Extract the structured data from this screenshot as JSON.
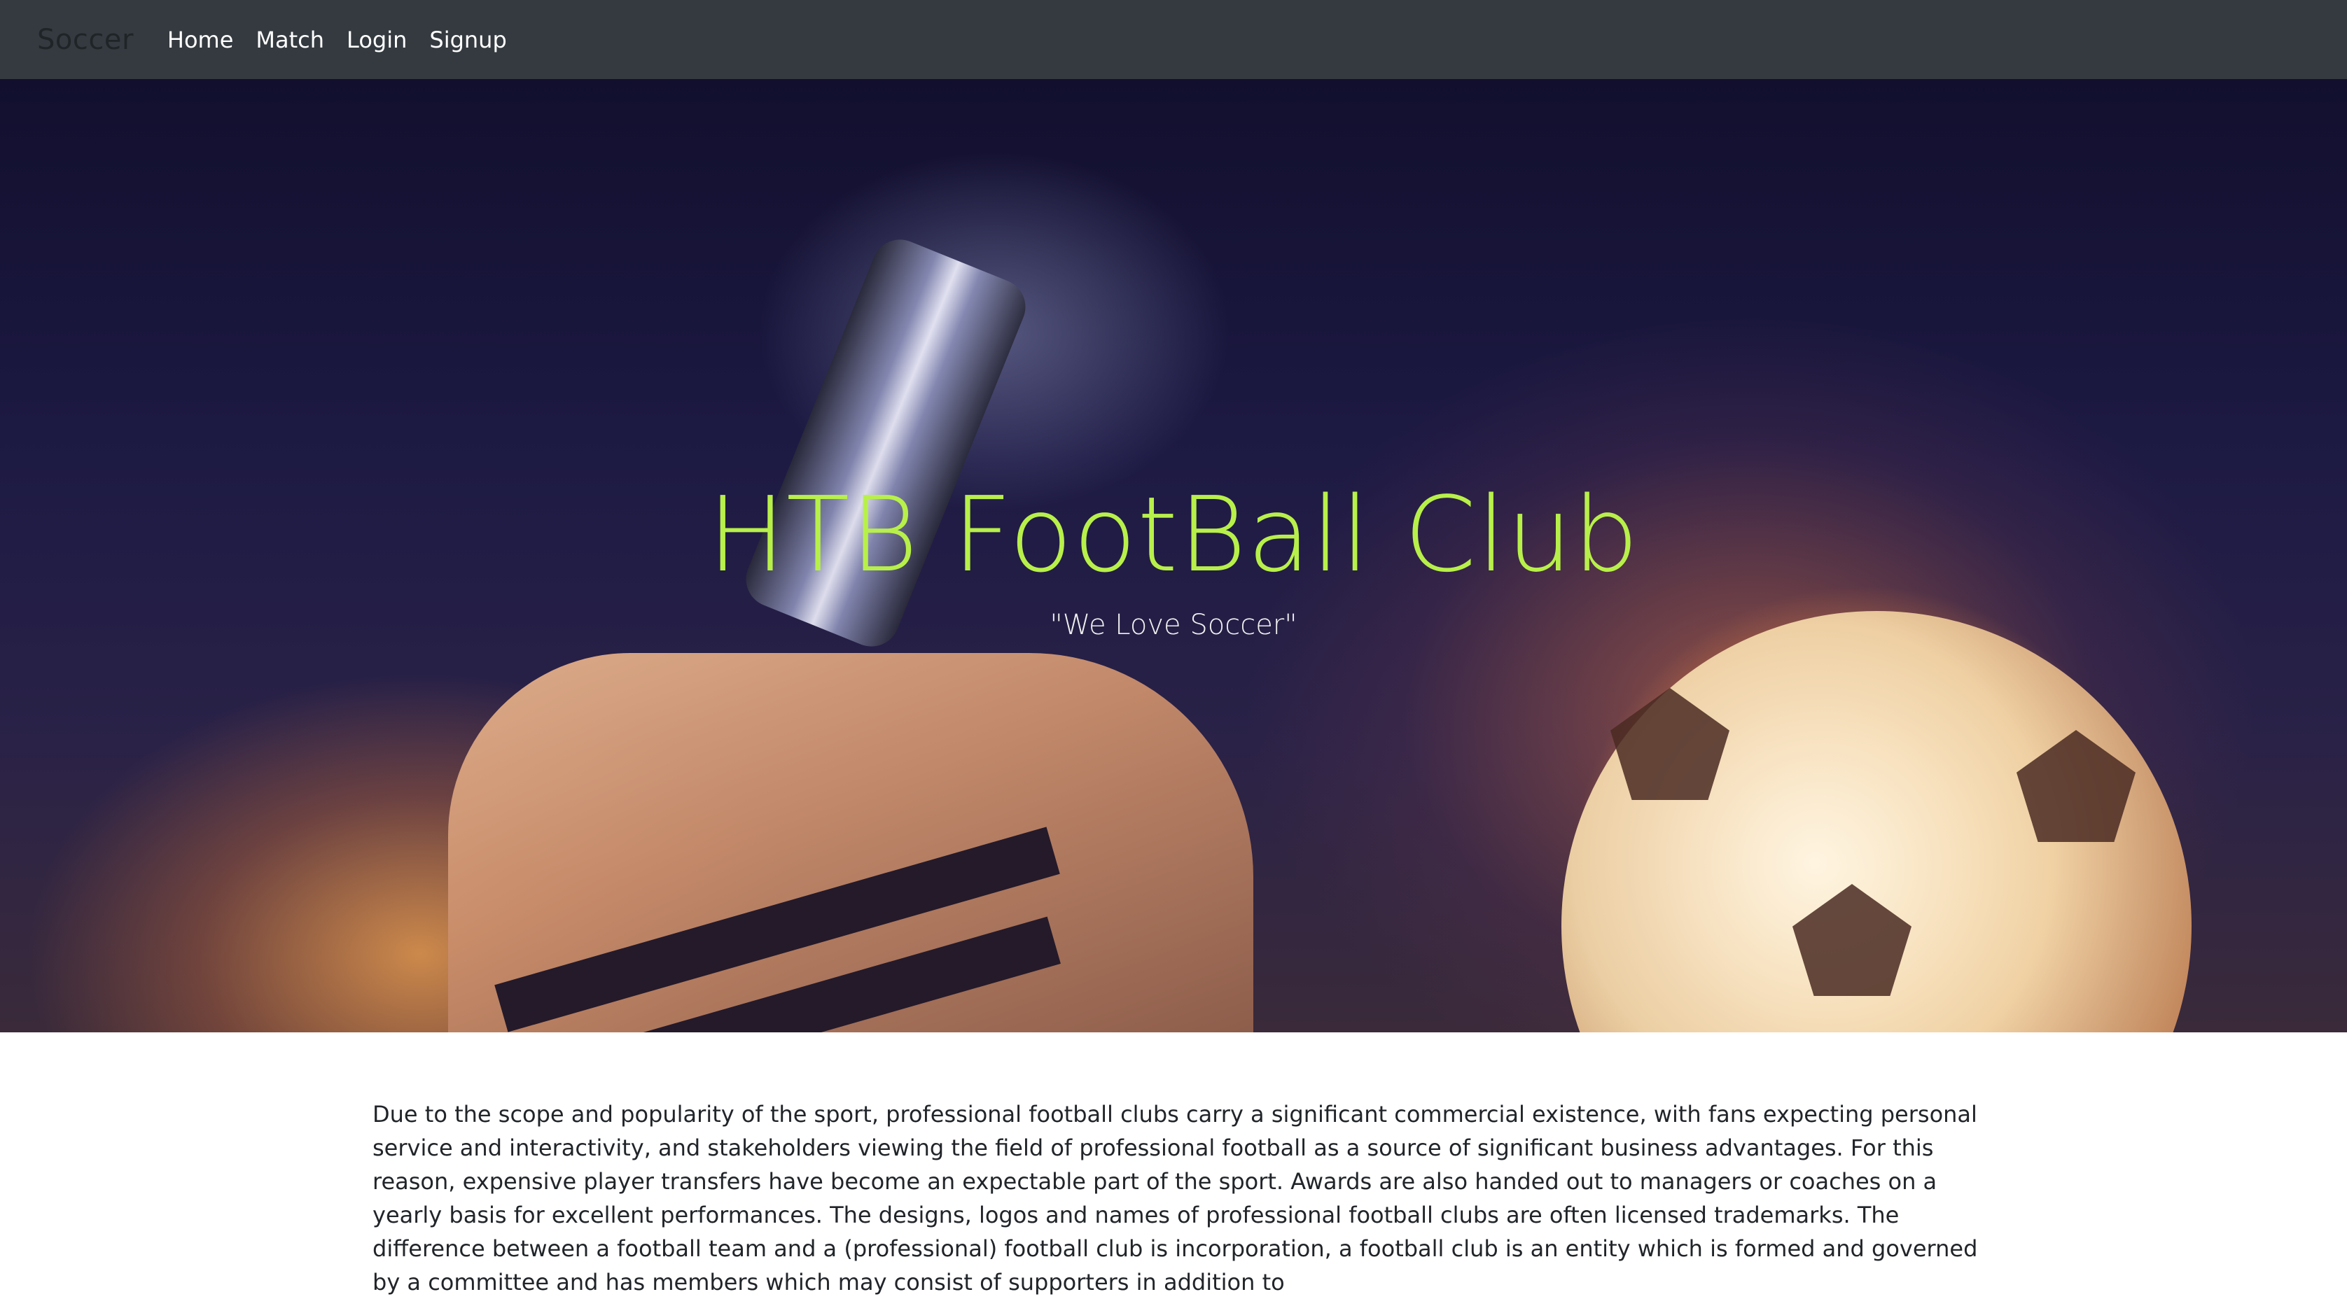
{
  "navbar": {
    "brand": "Soccer",
    "links": [
      {
        "label": "Home"
      },
      {
        "label": "Match"
      },
      {
        "label": "Login"
      },
      {
        "label": "Signup"
      }
    ]
  },
  "hero": {
    "title": "HTB FootBall Club",
    "subtitle": "\"We Love Soccer\""
  },
  "content": {
    "paragraph": "Due to the scope and popularity of the sport, professional football clubs carry a significant commercial existence, with fans expecting personal service and interactivity, and stakeholders viewing the field of professional football as a source of significant business advantages. For this reason, expensive player transfers have become an expectable part of the sport. Awards are also handed out to managers or coaches on a yearly basis for excellent performances. The designs, logos and names of professional football clubs are often licensed trademarks. The difference between a football team and a (professional) football club is incorporation, a football club is an entity which is formed and governed by a committee and has members which may consist of supporters in addition to"
  },
  "colors": {
    "navbar_bg": "#343a40",
    "title_color": "#b8f04a",
    "body_text": "#212529"
  }
}
